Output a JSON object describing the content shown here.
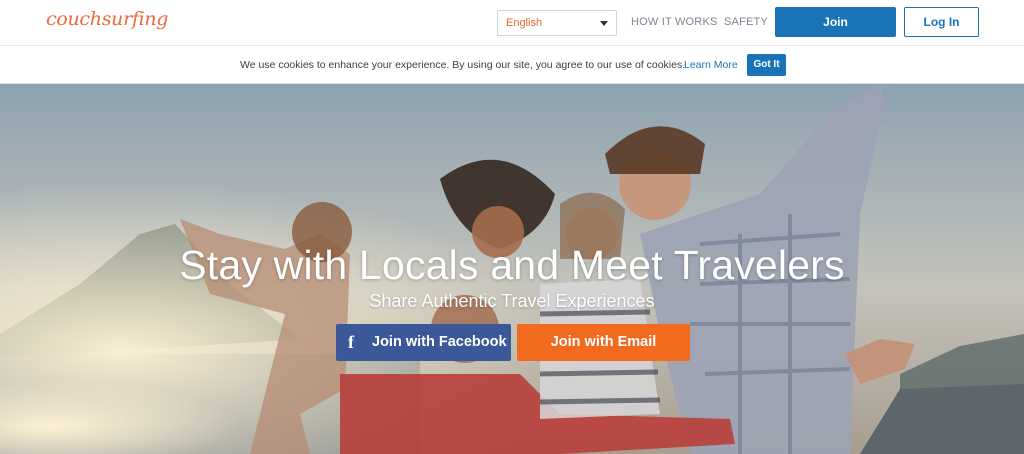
{
  "header": {
    "logo": "couchsurfing",
    "language": "English",
    "nav": [
      "HOW IT WORKS",
      "SAFETY"
    ],
    "join_label": "Join",
    "login_label": "Log In"
  },
  "cookie": {
    "text": "We use cookies to enhance your experience. By using our site, you agree to our use of cookies.",
    "learn_more": "Learn More",
    "got_it": "Got It"
  },
  "hero": {
    "title": "Stay with Locals and Meet Travelers",
    "subtitle": "Share Authentic Travel Experiences",
    "facebook_icon": "f",
    "facebook_label": "Join with Facebook",
    "email_label": "Join with Email"
  },
  "colors": {
    "brand_orange": "#ee6a3c",
    "primary_blue": "#1a72b7",
    "facebook_blue": "#3b5998",
    "email_orange": "#f16a1e"
  },
  "icons": {
    "language_caret": "caret-down-icon",
    "facebook": "facebook-icon"
  }
}
